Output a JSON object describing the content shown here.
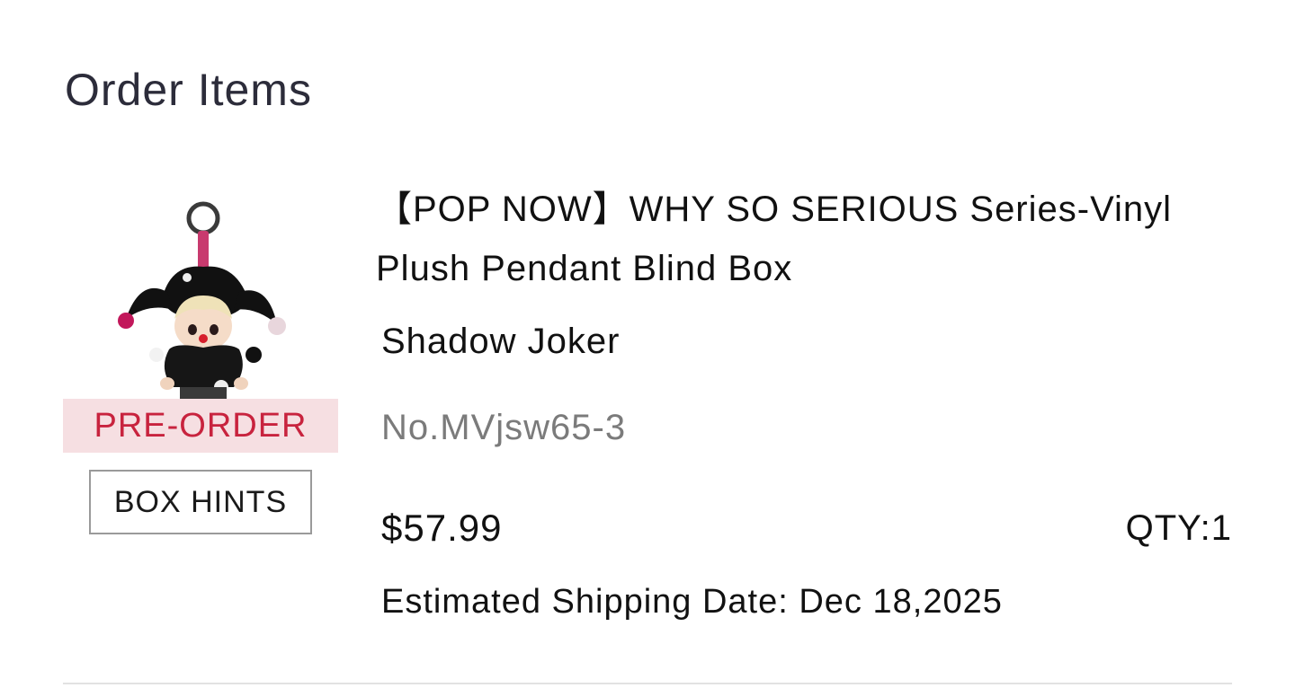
{
  "section": {
    "title": "Order Items"
  },
  "item": {
    "image_icon": "jester-plush-pendant",
    "status_badge": "PRE-ORDER",
    "box_hints_label": "BOX HINTS",
    "name": "【POP NOW】WHY SO SERIOUS Series-Vinyl Plush Pendant Blind Box",
    "variant": "Shadow Joker",
    "sku": "No.MVjsw65-3",
    "price": "$57.99",
    "quantity": "QTY:1",
    "shipping": "Estimated Shipping Date: Dec 18,2025"
  },
  "colors": {
    "badge_bg": "#f6dfe2",
    "badge_text": "#c8233e",
    "sku_text": "#7b7b7b",
    "title_text": "#2c2c3a"
  }
}
